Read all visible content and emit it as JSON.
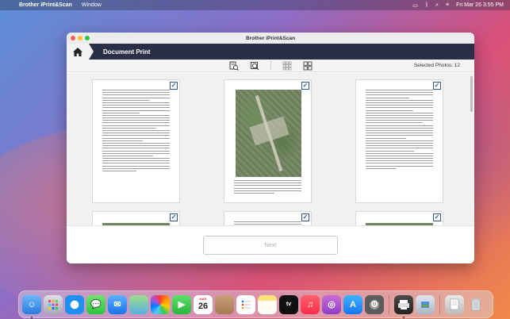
{
  "menubar": {
    "app_name": "Brother iPrint&Scan",
    "menu_items": [
      "Window"
    ],
    "clock": "Fri Mar 26  3:55 PM"
  },
  "window": {
    "title": "Brother iPrint&Scan",
    "header_title": "Document Print",
    "selected_photos": "Selected Photos: 12",
    "next_label": "Next",
    "check_glyph": "✓"
  },
  "toolbar_icons": [
    "zoom-in-doc-icon",
    "zoom-fit-icon",
    "grid-small-icon",
    "grid-large-icon"
  ],
  "pages": [
    {
      "kind": "text",
      "checked": true
    },
    {
      "kind": "aerial-photo",
      "checked": true
    },
    {
      "kind": "text",
      "checked": true
    },
    {
      "kind": "aerial-strip",
      "checked": true
    },
    {
      "kind": "text",
      "checked": true
    },
    {
      "kind": "aerial-strip",
      "checked": true
    }
  ],
  "dock": {
    "calendar_month": "MAR",
    "calendar_day": "26",
    "apps": [
      "Finder",
      "Launchpad",
      "Safari",
      "Messages",
      "Mail",
      "Maps",
      "Photos",
      "FaceTime",
      "Calendar",
      "Contacts",
      "Reminders",
      "Notes",
      "TV",
      "Music",
      "Podcasts",
      "App Store",
      "System Preferences",
      "Brother iPrint&Scan",
      "Preview",
      "Documents",
      "Trash"
    ]
  }
}
